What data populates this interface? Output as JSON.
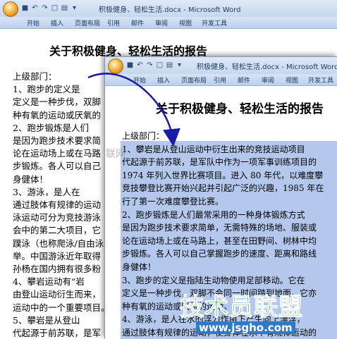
{
  "back_window": {
    "title": "积极健身、轻松生活.docx - Microsoft Word",
    "tabs": [
      "开始",
      "插入",
      "页面布局",
      "引用",
      "邮件",
      "审阅",
      "视图",
      "开发工具"
    ],
    "doc_title": "关于积极健身、轻松生活的报告",
    "lines": [
      "上级部门：",
      "    1、跑步的定义是",
      "定义是一种步伐，双脚",
      "种有氧的运动或厌氧的",
      "    2、跑步锻炼是人们",
      "是因为跑步技术要求简",
      "论在运动场上或在马路",
      "步锻炼。各人可以自己",
      "身健体！",
      "    3、游泳，是人在",
      "通过肢体有规律的运动",
      "泳运动可分为竞技游泳",
      "会中的第二大项目，它",
      "蹼泳（也称爬泳/自由泳",
      "举。中国游泳近年取得",
      "孙杨在国内拥有很多粉",
      "    4、攀岩运动有“岩",
      "由登山运动衍生而来，",
      "运动中的一个重要项目。",
      "    5、攀岩是从登山",
      "代起源于前苏联，是军",
      "1974 年列入世界比赛"
    ]
  },
  "front_window": {
    "title": "积极健身、轻松生活.docx - Microsoft Word",
    "tabs": [
      "开始",
      "插入",
      "页面布局",
      "引用",
      "邮件",
      "审阅",
      "视图",
      "开发工具"
    ],
    "doc_title": "关于积极健身、轻松生活的报告",
    "lines": [
      "上级部门：",
      "    1、攀岩是从登山运动中衍生出来的竞技运动项目",
      "代起源于前苏联，是军队中作为一项军事训练项目的",
      "1974 年列入世界比赛项目。进入 80 年代，以难度攀",
      "竞技攀登比赛开始兴起并引起广泛的兴趣，1985 年在",
      "行了第一次难度攀登比赛。",
      "    2、跑步锻炼是人们最常采用的一种身体锻炼方式",
      "是因为跑步技术要求简单，无需特殊的场地、服装或",
      "论在运动场上或在马路上，甚至在田野间、树林中均",
      "步锻炼。各人可以自己掌握跑步的速度、距离和路线",
      "身健体！",
      "    3、跑步的定义是指陆生动物使用足部移动。它在",
      "定义是一种步伐，双脚不会同一时间踏到地面。它亦",
      "种有氧的运动或厌氧的运动。",
      "    4、游泳，是人在水的浮力作用下产生向上漂浮，",
      "通过肢体有规律的运动，使身体在水中有规律运动的",
      "泳运动可分为竞技游泳和实用游泳两类。游泳是奥林"
    ]
  },
  "watermark": {
    "text": "技术员联盟",
    "url": "www.jsgho.com",
    "faint": "联网"
  }
}
